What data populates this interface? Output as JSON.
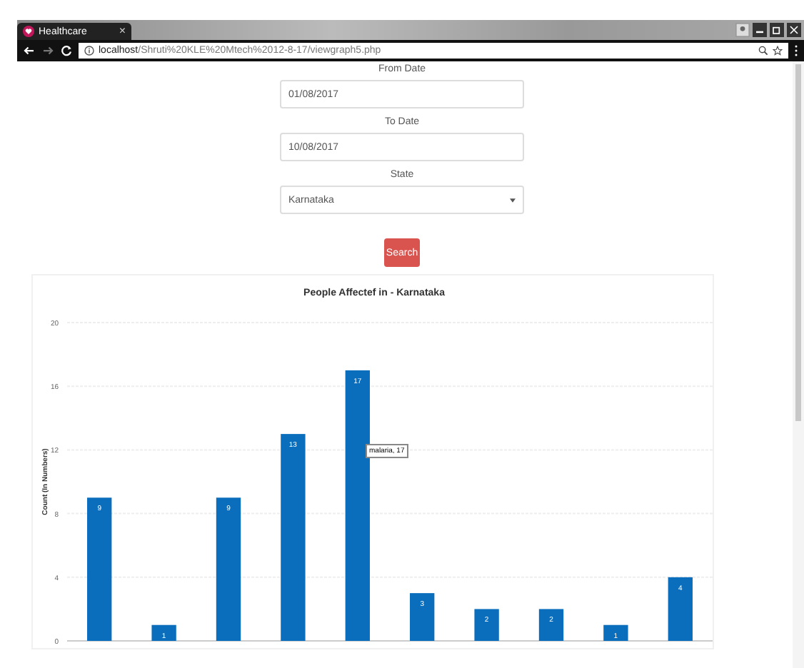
{
  "browser": {
    "tab_title": "Healthcare",
    "tab_close": "×",
    "url_host": "localhost",
    "url_path": "/Shruti%20KLE%20Mtech%2012-8-17/viewgraph5.php"
  },
  "form": {
    "fields": [
      {
        "label": "From Date",
        "kind": "text",
        "value": "01/08/2017"
      },
      {
        "label": "To Date",
        "kind": "text",
        "value": "10/08/2017"
      },
      {
        "label": "State",
        "kind": "select",
        "value": "Karnataka"
      }
    ],
    "button": "Search"
  },
  "chart": {
    "chart_data": {
      "type": "bar",
      "title": "People Affectef in - Karnataka",
      "ylabel": "Count (In Numbers)",
      "values": [
        9,
        1,
        9,
        13,
        17,
        3,
        2,
        2,
        1,
        4
      ],
      "ylim": [
        0,
        20
      ],
      "yticks": [
        0,
        4,
        8,
        12,
        16,
        20
      ],
      "data_labels": true,
      "grid": true
    },
    "tooltip": "malaria, 17"
  }
}
